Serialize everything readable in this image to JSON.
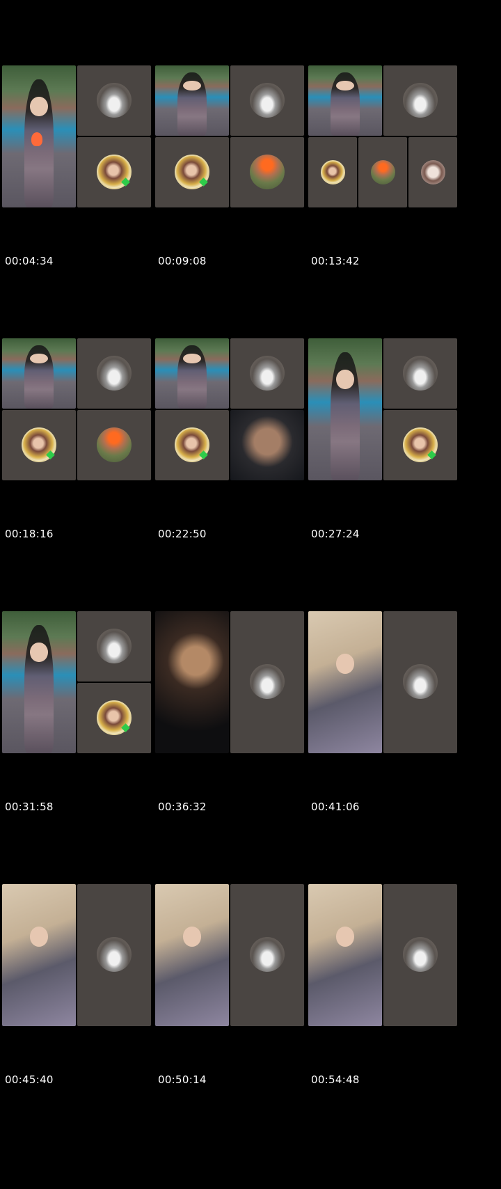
{
  "thumbnails": [
    {
      "time": "00:04:34"
    },
    {
      "time": "00:09:08"
    },
    {
      "time": "00:13:42"
    },
    {
      "time": "00:18:16"
    },
    {
      "time": "00:22:50"
    },
    {
      "time": "00:27:24"
    },
    {
      "time": "00:31:58"
    },
    {
      "time": "00:36:32"
    },
    {
      "time": "00:41:06"
    },
    {
      "time": "00:45:40"
    },
    {
      "time": "00:50:14"
    },
    {
      "time": "00:54:48"
    }
  ],
  "colors": {
    "background": "#000000",
    "tile": "#4a4542",
    "timestamp_text": "#ffffff"
  },
  "icons": [
    "car-avatar-icon",
    "girl-avatar-icon",
    "man-avatar-icon",
    "woman-avatar-icon"
  ]
}
